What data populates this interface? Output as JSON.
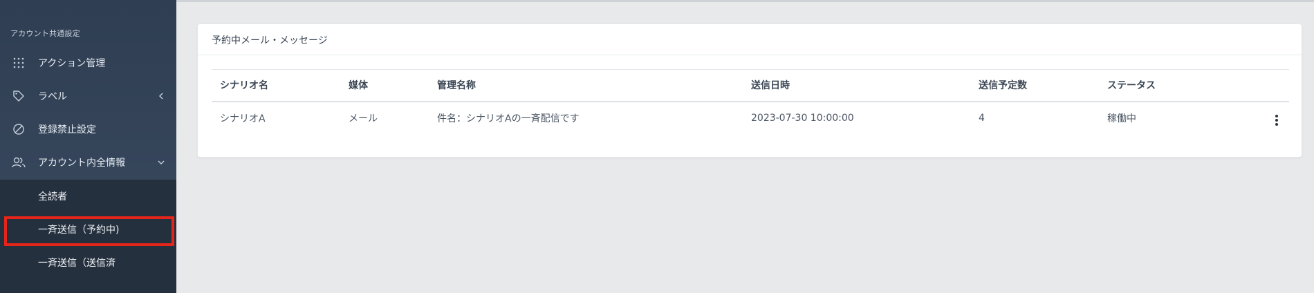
{
  "sidebar": {
    "section_title": "アカウント共通設定",
    "items": [
      {
        "label": "アクション管理",
        "icon": "grid-dots-icon"
      },
      {
        "label": "ラベル",
        "icon": "tag-icon",
        "chevron": "chevron-left-icon"
      },
      {
        "label": "登録禁止設定",
        "icon": "prohibited-icon"
      },
      {
        "label": "アカウント内全情報",
        "icon": "users-icon",
        "chevron": "chevron-down-icon"
      }
    ],
    "subitems": [
      {
        "label": "全読者"
      },
      {
        "label": "一斉送信（予約中)"
      },
      {
        "label": "一斉送信（送信済"
      }
    ],
    "highlight_color": "#e5251a"
  },
  "card": {
    "title": "予約中メール・メッセージ"
  },
  "table": {
    "headers": [
      "シナリオ名",
      "媒体",
      "管理名称",
      "送信日時",
      "送信予定数",
      "ステータス"
    ],
    "rows": [
      {
        "scenario": "シナリオA",
        "media": "メール",
        "name": "件名：シナリオAの一斉配信です",
        "datetime": "2023-07-30 10:00:00",
        "count": "4",
        "status": "稼働中"
      }
    ]
  }
}
